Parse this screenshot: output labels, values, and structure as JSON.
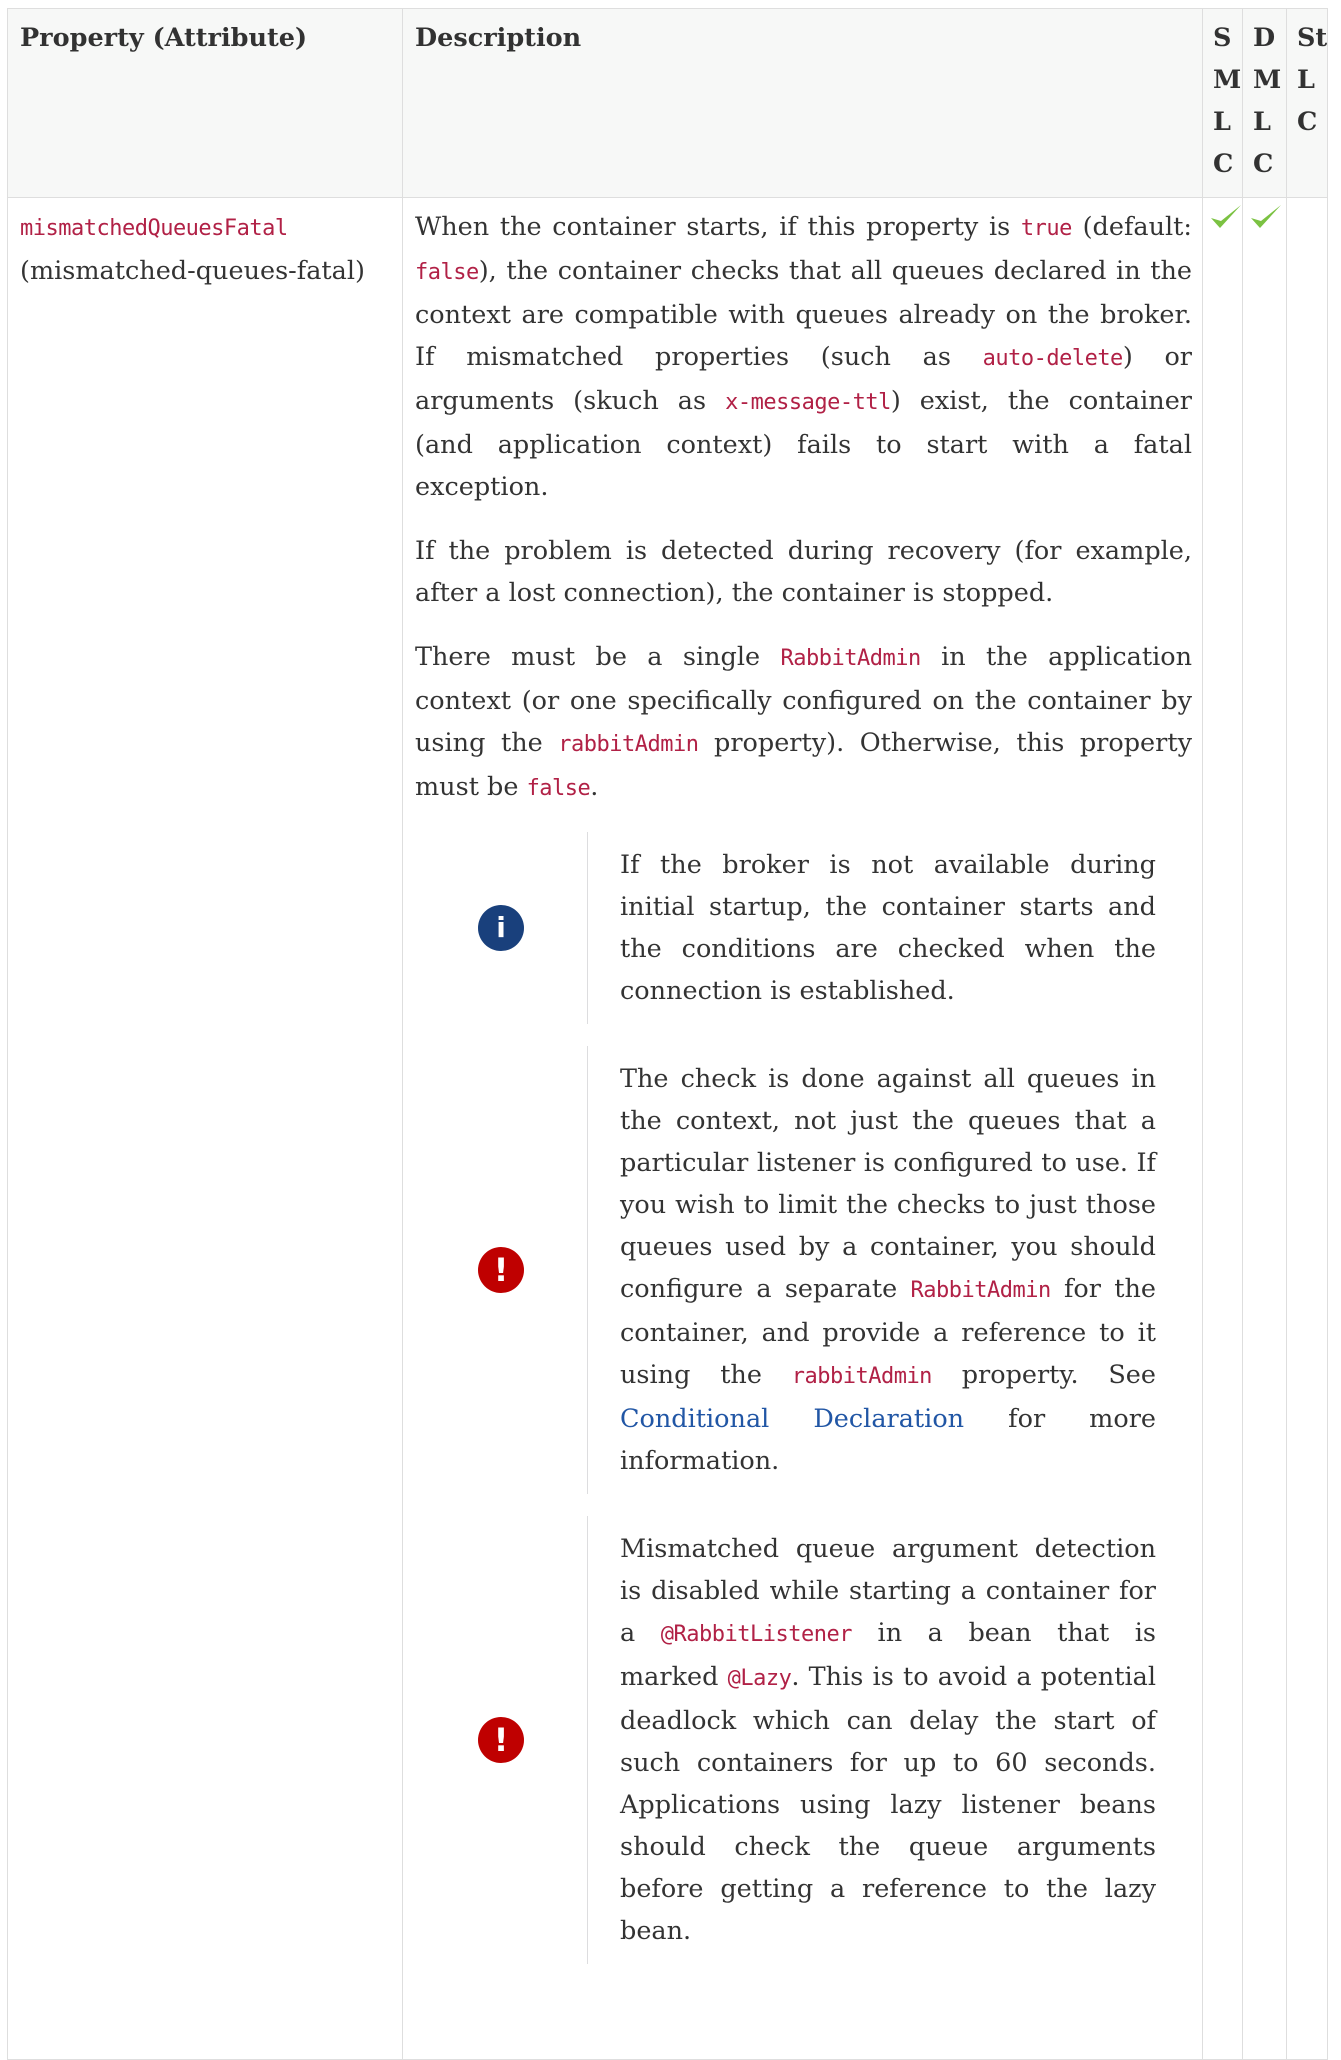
{
  "header": {
    "col_property": "Property (Attribute)",
    "col_description": "Description",
    "col_smlc": [
      "S",
      "M",
      "L",
      "C"
    ],
    "col_dmlc": [
      "D",
      "M",
      "L",
      "C"
    ],
    "col_stlc": [
      "St",
      "L",
      "C"
    ]
  },
  "row": {
    "property_code": "mismatchedQueuesFatal",
    "attribute": "(mismatched-queues-fatal)",
    "para1": {
      "t1": "When the container starts, if this property is ",
      "c1": "true",
      "t2": " (default: ",
      "c2": "false",
      "t3": "), the container checks that all queues declared in the context are compatible with queues already on the broker. If mismatched properties (such as ",
      "c3": "auto-delete",
      "t4": ") or arguments (skuch as ",
      "c4": "x-message-ttl",
      "t5": ") exist, the container (and application context) fails to start with a fatal exception."
    },
    "para2": "If the problem is detected during recovery (for example, after a lost connection), the container is stopped.",
    "para3": {
      "t1": "There must be a single ",
      "c1": "RabbitAdmin",
      "t2": " in the application context (or one specifically configured on the container by using the ",
      "c2": "rabbitAdmin",
      "t3": " property). Otherwise, this property must be ",
      "c3": "false",
      "t4": "."
    },
    "note1": {
      "icon": "info-icon",
      "text": "If the broker is not available during initial startup, the container starts and the conditions are checked when the connection is established."
    },
    "note2": {
      "icon": "warning-icon",
      "t1": "The check is done against all queues in the context, not just the queues that a particular listener is configured to use. If you wish to limit the checks to just those queues used by a container, you should configure a separate ",
      "c1": "RabbitAdmin",
      "t2": " for the container, and provide a reference to it using the ",
      "c2": "rabbitAdmin",
      "t3": " property. See ",
      "link": "Conditional Declaration",
      "t4": " for more information."
    },
    "note3": {
      "icon": "warning-icon",
      "t1": "Mismatched queue argument detection is disabled while starting a container for a ",
      "c1": "@RabbitListener",
      "t2": " in a bean that is marked ",
      "c2": "@Lazy",
      "t3": ". This is to avoid a potential deadlock which can delay the start of such containers for up to 60 seconds. Applications using lazy listener beans should check the queue arguments before getting a reference to the lazy bean."
    },
    "smlc_supported": true,
    "dmlc_supported": true,
    "stlc_supported": false
  },
  "colors": {
    "code": "#b12146",
    "link": "#2156a5",
    "info_icon": "#19407c",
    "warning_icon": "#bf0000",
    "check": "#7bc242"
  }
}
